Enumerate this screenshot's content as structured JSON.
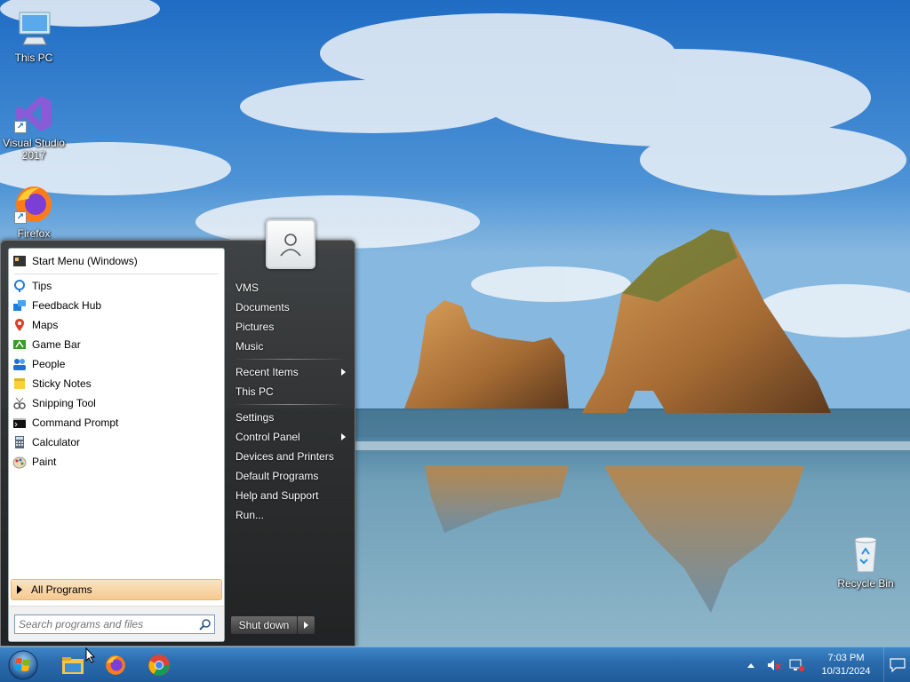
{
  "desktop": {
    "icons": [
      {
        "label": "This PC",
        "icon": "monitor-icon"
      },
      {
        "label": "Visual Studio 2017",
        "icon": "visual-studio-icon"
      },
      {
        "label": "Firefox",
        "icon": "firefox-icon"
      },
      {
        "label": "Recycle Bin",
        "icon": "recycle-bin-icon"
      }
    ]
  },
  "start_menu": {
    "pinned": [
      {
        "label": "Start Menu (Windows)",
        "icon": "start-menu-icon"
      }
    ],
    "programs": [
      {
        "label": "Tips",
        "icon": "tips-icon"
      },
      {
        "label": "Feedback Hub",
        "icon": "feedback-hub-icon"
      },
      {
        "label": "Maps",
        "icon": "maps-icon"
      },
      {
        "label": "Game Bar",
        "icon": "game-bar-icon"
      },
      {
        "label": "People",
        "icon": "people-icon"
      },
      {
        "label": "Sticky Notes",
        "icon": "sticky-notes-icon"
      },
      {
        "label": "Snipping Tool",
        "icon": "snipping-tool-icon"
      },
      {
        "label": "Command Prompt",
        "icon": "command-prompt-icon"
      },
      {
        "label": "Calculator",
        "icon": "calculator-icon"
      },
      {
        "label": "Paint",
        "icon": "paint-icon"
      }
    ],
    "all_programs_label": "All Programs",
    "search": {
      "placeholder": "Search programs and files",
      "value": ""
    },
    "right_pane": {
      "group1": [
        "VMS",
        "Documents",
        "Pictures",
        "Music"
      ],
      "group2": [
        "Recent Items",
        "This PC"
      ],
      "group3": [
        "Settings",
        "Control Panel",
        "Devices and Printers",
        "Default Programs",
        "Help and Support",
        "Run..."
      ]
    },
    "shutdown_label": "Shut down"
  },
  "taskbar": {
    "apps": [
      {
        "name": "File Explorer",
        "icon": "file-explorer-icon"
      },
      {
        "name": "Firefox",
        "icon": "firefox-icon"
      },
      {
        "name": "Chrome",
        "icon": "chrome-icon"
      }
    ],
    "tray": {
      "time": "7:03 PM",
      "date": "10/31/2024"
    }
  },
  "colors": {
    "taskbar": "#2b6cad",
    "all_programs_highlight": "#f6c98f"
  }
}
